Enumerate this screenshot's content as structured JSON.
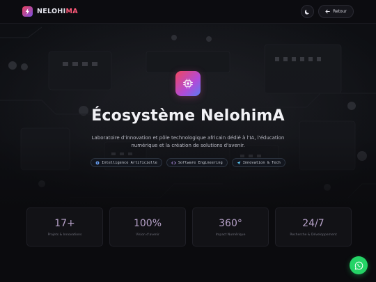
{
  "brand": {
    "name_part1": "NELOHI",
    "name_part2": "MA",
    "logo_icon": "lightning-bolt-icon",
    "accent_gradient": [
      "#e9435c",
      "#7b4fe0"
    ]
  },
  "nav": {
    "theme_toggle_icon": "moon-icon",
    "back_icon": "arrow-left-icon",
    "back_label": "Retour"
  },
  "hero": {
    "icon": "chip-icon",
    "title": "Écosystème NelohimA",
    "description": "Laboratoire d'innovation et pôle technologique africain dédié à l'IA, l'éducation numérique et la création de solutions d'avenir.",
    "tags": [
      {
        "label": "Intelligence Artificielle",
        "icon": "brain-icon",
        "color": "#6fa8ff"
      },
      {
        "label": "Software Engineering",
        "icon": "code-icon",
        "color": "#c9a0ff"
      },
      {
        "label": "Innovation & Tech",
        "icon": "rocket-icon",
        "color": "#5fd0ff"
      }
    ]
  },
  "stats": [
    {
      "value": "17+",
      "label": "Projets & Innovations"
    },
    {
      "value": "100%",
      "label": "Vision d'avenir"
    },
    {
      "value": "360°",
      "label": "Impact Numérique"
    },
    {
      "value": "24/7",
      "label": "Recherche & Développement"
    }
  ],
  "whatsapp": {
    "icon": "whatsapp-icon",
    "color": "#25d366"
  }
}
